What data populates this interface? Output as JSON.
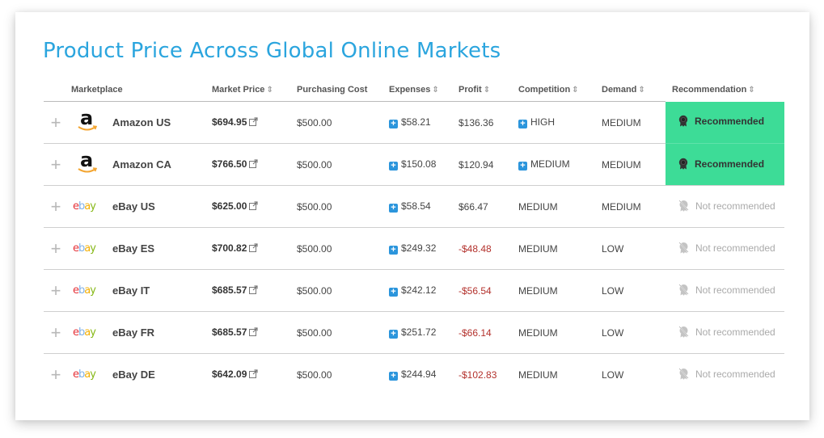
{
  "title": "Product Price Across Global Online Markets",
  "columns": {
    "marketplace": "Marketplace",
    "market_price": "Market Price",
    "purchasing_cost": "Purchasing Cost",
    "expenses": "Expenses",
    "profit": "Profit",
    "competition": "Competition",
    "demand": "Demand",
    "recommendation": "Recommendation"
  },
  "sort_glyph": "⇕",
  "colors": {
    "title": "#2ba5de",
    "recommended_bg": "#3ddc97",
    "negative_profit": "#b3312c",
    "info_plus": "#2b95dc"
  },
  "rows": [
    {
      "logo": "amazon",
      "name": "Amazon US",
      "market_price": "$694.95",
      "purchasing_cost": "$500.00",
      "expenses": "$58.21",
      "profit": "$136.36",
      "profit_negative": false,
      "competition": "HIGH",
      "competition_expandable": true,
      "demand": "MEDIUM",
      "recommendation": "Recommended",
      "recommended": true
    },
    {
      "logo": "amazon",
      "name": "Amazon CA",
      "market_price": "$766.50",
      "purchasing_cost": "$500.00",
      "expenses": "$150.08",
      "profit": "$120.94",
      "profit_negative": false,
      "competition": "MEDIUM",
      "competition_expandable": true,
      "demand": "MEDIUM",
      "recommendation": "Recommended",
      "recommended": true
    },
    {
      "logo": "ebay",
      "name": "eBay US",
      "market_price": "$625.00",
      "purchasing_cost": "$500.00",
      "expenses": "$58.54",
      "profit": "$66.47",
      "profit_negative": false,
      "competition": "MEDIUM",
      "competition_expandable": false,
      "demand": "MEDIUM",
      "recommendation": "Not recommended",
      "recommended": false
    },
    {
      "logo": "ebay",
      "name": "eBay ES",
      "market_price": "$700.82",
      "purchasing_cost": "$500.00",
      "expenses": "$249.32",
      "profit": "-$48.48",
      "profit_negative": true,
      "competition": "MEDIUM",
      "competition_expandable": false,
      "demand": "LOW",
      "recommendation": "Not recommended",
      "recommended": false
    },
    {
      "logo": "ebay",
      "name": "eBay IT",
      "market_price": "$685.57",
      "purchasing_cost": "$500.00",
      "expenses": "$242.12",
      "profit": "-$56.54",
      "profit_negative": true,
      "competition": "MEDIUM",
      "competition_expandable": false,
      "demand": "LOW",
      "recommendation": "Not recommended",
      "recommended": false
    },
    {
      "logo": "ebay",
      "name": "eBay FR",
      "market_price": "$685.57",
      "purchasing_cost": "$500.00",
      "expenses": "$251.72",
      "profit": "-$66.14",
      "profit_negative": true,
      "competition": "MEDIUM",
      "competition_expandable": false,
      "demand": "LOW",
      "recommendation": "Not recommended",
      "recommended": false
    },
    {
      "logo": "ebay",
      "name": "eBay DE",
      "market_price": "$642.09",
      "purchasing_cost": "$500.00",
      "expenses": "$244.94",
      "profit": "-$102.83",
      "profit_negative": true,
      "competition": "MEDIUM",
      "competition_expandable": false,
      "demand": "LOW",
      "recommendation": "Not recommended",
      "recommended": false
    }
  ],
  "logos": {
    "amazon": {
      "letter": "a"
    },
    "ebay": {
      "letters": [
        "e",
        "b",
        "a",
        "y"
      ]
    }
  },
  "icons": {
    "row_expand": "+",
    "info_plus": "+"
  }
}
